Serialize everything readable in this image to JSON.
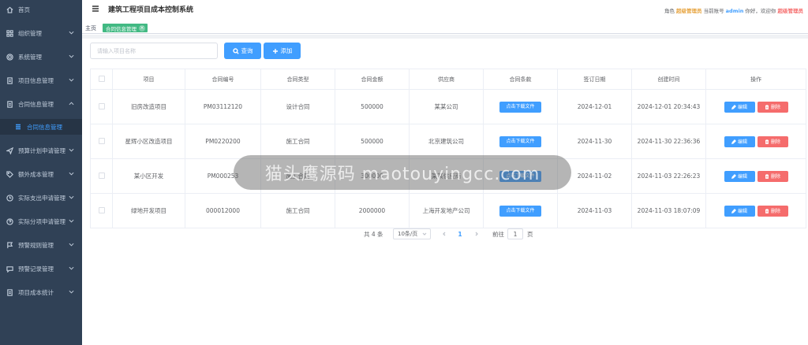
{
  "sidebar": {
    "items": [
      {
        "label": "首页",
        "icon": "home-icon"
      },
      {
        "label": "组织管理",
        "icon": "grid-icon"
      },
      {
        "label": "系统管理",
        "icon": "gear-icon"
      },
      {
        "label": "项目信息管理",
        "icon": "document-icon"
      },
      {
        "label": "合同信息管理",
        "icon": "document-icon"
      },
      {
        "label": "预算计划申请管理",
        "icon": "send-icon"
      },
      {
        "label": "额外成本管理",
        "icon": "tag-icon"
      },
      {
        "label": "实际支出申请管理",
        "icon": "clock-icon"
      },
      {
        "label": "实际分项申请管理",
        "icon": "help-icon"
      },
      {
        "label": "预警规则管理",
        "icon": "flag-icon"
      },
      {
        "label": "预警记录管理",
        "icon": "chat-icon"
      },
      {
        "label": "项目成本统计",
        "icon": "document-icon"
      }
    ],
    "submenu_active": "合同信息管理"
  },
  "header": {
    "title": "建筑工程项目成本控制系统",
    "role_label": "角色",
    "role": "超级管理员",
    "account_label": "当前账号",
    "account": "admin",
    "welcome": "你好，欢迎你",
    "welcome_name": "超级管理员"
  },
  "tags": {
    "home": "主页",
    "active": "合同信息管理"
  },
  "toolbar": {
    "search_placeholder": "请输入项目名称",
    "query_label": "查询",
    "add_label": "添加"
  },
  "table": {
    "headers": [
      "项目",
      "合同编号",
      "合同类型",
      "合同金额",
      "供应商",
      "合同条款",
      "签订日期",
      "创建时间",
      "操作"
    ],
    "download_label": "点击下载文件",
    "edit_label": "编辑",
    "delete_label": "删除",
    "rows": [
      {
        "project": "旧房改造项目",
        "code": "PM03112120",
        "type": "设计合同",
        "amount": "500000",
        "supplier": "某某公司",
        "sign_date": "2024-12-01",
        "created": "2024-12-01 20:34:43"
      },
      {
        "project": "星辉小区改造项目",
        "code": "PM0220200",
        "type": "施工合同",
        "amount": "500000",
        "supplier": "北京建筑公司",
        "sign_date": "2024-11-30",
        "created": "2024-11-30 22:36:36"
      },
      {
        "project": "某小区开发",
        "code": "PM000253",
        "type": "施工合同",
        "amount": "300000",
        "supplier": "某某供应商",
        "sign_date": "2024-11-02",
        "created": "2024-11-03 22:26:23"
      },
      {
        "project": "绿地开发项目",
        "code": "000012000",
        "type": "施工合同",
        "amount": "2000000",
        "supplier": "上海开发地产公司",
        "sign_date": "2024-11-03",
        "created": "2024-11-03 18:07:09"
      }
    ]
  },
  "pagination": {
    "total": "共 4 条",
    "page_size": "10条/页",
    "current": "1",
    "goto_label": "前往",
    "goto_value": "1",
    "goto_unit": "页"
  },
  "watermark": {
    "text": "猫头鹰源码 maotouyingcc.com"
  },
  "colors": {
    "sidebar_bg": "#304156",
    "primary": "#409eff",
    "danger": "#f56c6c",
    "tag": "#42b983"
  }
}
